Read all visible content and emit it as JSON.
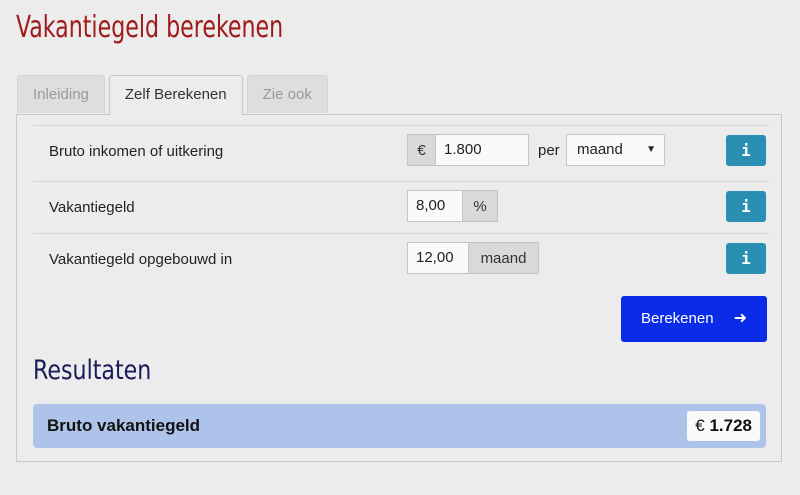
{
  "page": {
    "title": "Vakantiegeld berekenen"
  },
  "tabs": [
    {
      "label": "Inleiding",
      "active": false
    },
    {
      "label": "Zelf Berekenen",
      "active": true
    },
    {
      "label": "Zie ook",
      "active": false
    }
  ],
  "form": {
    "income": {
      "label": "Bruto inkomen of uitkering",
      "currency": "€",
      "value": "1.800",
      "per_label": "per",
      "period": "maand",
      "info": "i"
    },
    "holiday_pay": {
      "label": "Vakantiegeld",
      "value": "8,00",
      "unit": "%",
      "info": "i"
    },
    "accrued": {
      "label": "Vakantiegeld opgebouwd in",
      "value": "12,00",
      "unit": "maand",
      "info": "i"
    },
    "calculate_label": "Berekenen",
    "calculate_icon": "arrow-right-icon"
  },
  "results": {
    "title": "Resultaten",
    "gross_label": "Bruto vakantiegeld",
    "gross_currency": "€",
    "gross_value": "1.728"
  },
  "colors": {
    "title": "#a01c1c",
    "info_button": "#2990b3",
    "primary_button": "#0a2be8",
    "result_bar": "#aec3ea"
  }
}
